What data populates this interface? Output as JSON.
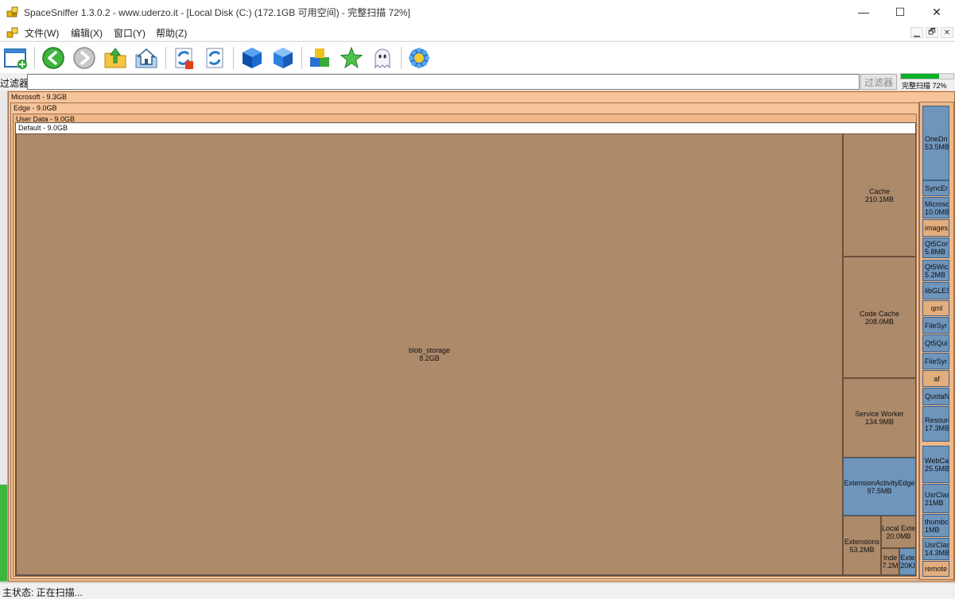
{
  "window": {
    "title": "SpaceSniffer 1.3.0.2 - www.uderzo.it - [Local Disk (C:) (172.1GB 可用空间) - 完整扫描 72%]",
    "minimize_label": "—",
    "maximize_label": "☐",
    "close_label": "✕"
  },
  "menu": {
    "items": [
      "文件(W)",
      "编辑(X)",
      "窗口(Y)",
      "帮助(Z)"
    ],
    "mdi_buttons": [
      "▁",
      "🗗",
      "✕"
    ]
  },
  "toolbar": {
    "icons": [
      "new-view-icon",
      "back-arrow-icon",
      "forward-arrow-icon",
      "parent-folder-icon",
      "home-folder-icon",
      "refresh-sync-icon",
      "refresh-icon",
      "blue-cube-icon",
      "blue-cube-2-icon",
      "color-boxes-icon",
      "star-icon",
      "ghost-icon",
      "settings-gear-icon"
    ]
  },
  "filter": {
    "label": "过滤器",
    "input_value": "",
    "button_label": "过滤器"
  },
  "progress": {
    "label": "完整扫描 72%",
    "fraction": 0.72,
    "color": "#06b025"
  },
  "treemap": {
    "levels": [
      {
        "label": "Microsoft - 9.3GB"
      },
      {
        "label": "Edge - 9.0GB"
      },
      {
        "label": "User Data - 9.0GB"
      },
      {
        "label": "Default - 9.0GB"
      }
    ],
    "blob": {
      "name": "blob_storage",
      "size": "8.2GB"
    },
    "right_column": [
      {
        "name": "Cache",
        "size": "210.1MB"
      },
      {
        "name": "Code Cache",
        "size": "208.0MB"
      },
      {
        "name": "Service Worker",
        "size": "134.9MB"
      },
      {
        "name": "ExtensionActivityEdge",
        "size": "97.5MB"
      },
      {
        "name": "Extensions",
        "size": "53.2MB"
      },
      {
        "name": "Local Exte",
        "size": "20.0MB"
      },
      {
        "name": "Inde",
        "size": "7.2M"
      },
      {
        "name": "Exte",
        "size": "20KI"
      }
    ],
    "sidebar": [
      {
        "name": "OneDri",
        "size": "53.5MB"
      },
      {
        "name": "SyncEr",
        "size": ""
      },
      {
        "name": "Microsc",
        "size": "10.0MB"
      },
      {
        "name": "images",
        "size": ""
      },
      {
        "name": "Qt5Cor",
        "size": "5.8MB"
      },
      {
        "name": "Qt5Wic",
        "size": "5.2MB"
      },
      {
        "name": "libGLES",
        "size": ""
      },
      {
        "name": "qml",
        "size": ""
      },
      {
        "name": "FileSyr",
        "size": ""
      },
      {
        "name": "Qt5Qui",
        "size": ""
      },
      {
        "name": "FileSyr",
        "size": ""
      },
      {
        "name": "af",
        "size": ""
      },
      {
        "name": "QuotaN",
        "size": ""
      },
      {
        "name": "Resource",
        "size": "17.3MB"
      },
      {
        "name": "WebCa",
        "size": "25.5MB"
      },
      {
        "name": "UsrClass",
        "size": "21MB"
      },
      {
        "name": "thumbc",
        "size": "1MB"
      },
      {
        "name": "UsrClass",
        "size": "14.3MB"
      },
      {
        "name": "remote",
        "size": ""
      }
    ],
    "colors": {
      "folder": "#ad8a6a",
      "file": "#6f95bb",
      "header": "#f7c49a"
    }
  },
  "status": {
    "text": "主状态: 正在扫描..."
  }
}
